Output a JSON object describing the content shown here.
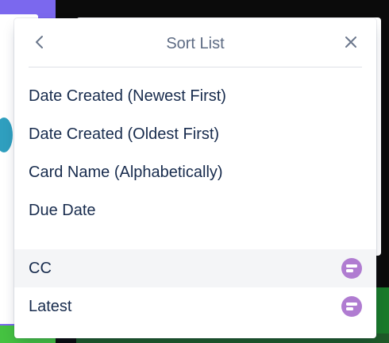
{
  "popover": {
    "title": "Sort List",
    "back_icon": "chevron-left-icon",
    "close_icon": "close-icon"
  },
  "sort_options": [
    {
      "label": "Date Created (Newest First)"
    },
    {
      "label": "Date Created (Oldest First)"
    },
    {
      "label": "Card Name (Alphabetically)"
    },
    {
      "label": "Due Date"
    }
  ],
  "saved_sorts": [
    {
      "label": "CC",
      "icon": "card-sort-icon",
      "highlighted": true
    },
    {
      "label": "Latest",
      "icon": "card-sort-icon",
      "highlighted": false
    }
  ],
  "colors": {
    "badge": "#b07cd1",
    "text": "#172b4d",
    "title": "#5e6c84",
    "highlight": "#f4f5f7"
  }
}
